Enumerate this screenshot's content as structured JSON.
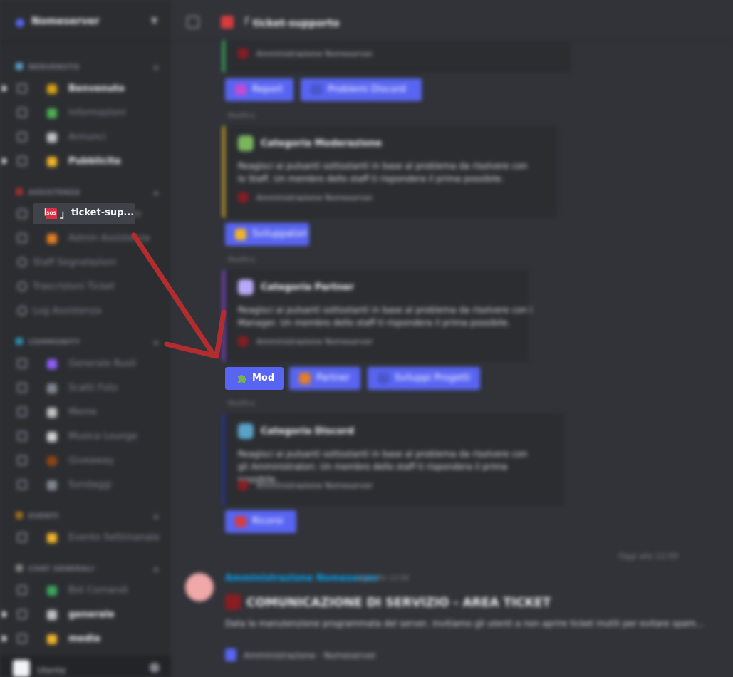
{
  "server": {
    "name": "Nomeserver"
  },
  "categories": [
    {
      "label": "Benvenuto",
      "color": "#5aa2c8"
    },
    {
      "label": "Assistenza",
      "color": "#a13131"
    },
    {
      "label": "Community",
      "color": "#2f8fb0"
    },
    {
      "label": "Eventi",
      "color": "#a06f1a"
    },
    {
      "label": "Chat Generali",
      "color": "#808080"
    }
  ],
  "channels": [
    {
      "label": "Benvenuto",
      "bold": true,
      "color": "#d4a017"
    },
    {
      "label": "Informazioni",
      "bold": false,
      "color": "#4caf50"
    },
    {
      "label": "Annunci",
      "bold": false,
      "color": "#c0c0c0"
    },
    {
      "label": "Pubblicita",
      "bold": true,
      "color": "#f0b429"
    },
    {
      "label": "Ticket Supporto",
      "bold": false,
      "color": "#d83c3e"
    },
    {
      "label": "Admin Assistenza",
      "bold": false,
      "color": "#e67e22"
    },
    {
      "label": "Staff Segnalazioni",
      "bold": false,
      "color": "#80848e"
    },
    {
      "label": "Trascrizioni Ticket",
      "bold": false,
      "color": "#80848e"
    },
    {
      "label": "Log Assistenza",
      "bold": false,
      "color": "#80848e"
    },
    {
      "label": "Generale Ruoli",
      "bold": false,
      "color": "#8e5cf7"
    },
    {
      "label": "Scatti Foto",
      "bold": false,
      "color": "#80848e"
    },
    {
      "label": "Meme",
      "bold": false,
      "color": "#c0c0c0"
    },
    {
      "label": "Musica Lounge",
      "bold": false,
      "color": "#d0d0d0"
    },
    {
      "label": "Giveaway",
      "bold": false,
      "color": "#8b4513"
    },
    {
      "label": "Sondaggi",
      "bold": false,
      "color": "#80848e"
    },
    {
      "label": "Evento Settimanale",
      "bold": false,
      "color": "#f0b429"
    },
    {
      "label": "Bot Comandi",
      "bold": false,
      "color": "#3ba55c"
    },
    {
      "label": "generale",
      "bold": true,
      "color": "#c0c0c0"
    },
    {
      "label": "media",
      "bold": true,
      "color": "#f0b429"
    }
  ],
  "highlighted_channel": {
    "bracket_left": "「",
    "icon_text": "SOS",
    "bracket_right": "」",
    "label": "ticket-sup..."
  },
  "user": {
    "name": "Utente"
  },
  "topbar": {
    "channel_name": "「 ticket-supporto"
  },
  "embeds": [
    {
      "title": "",
      "desc": "",
      "footer": "Amministrazione Nomeserver",
      "color": "#3ba55c",
      "icon_color": "#8b1c23"
    },
    {
      "title": "Categoria Moderazione",
      "desc": "Reagisci ai pulsanti sottostanti in base al problema da risolvere con lo Staff. Un membro dello staff ti rispondera il prima possibile.",
      "footer": "Amministrazione Nomeserver",
      "color": "#c5a028",
      "icon_color": "#7ab55c"
    },
    {
      "title": "Categoria Partner",
      "desc": "Reagisci ai pulsanti sottostanti in base al problema da risolvere con i Manager. Un membro dello staff ti rispondera il prima possibile.",
      "footer": "Amministrazione Nomeserver",
      "color": "#7b3fbf",
      "icon_color": "#b9a8f5"
    },
    {
      "title": "Categoria Discord",
      "desc": "Reagisci ai pulsanti sottostanti in base al problema da risolvere con gli Amministratori. Un membro dello staff ti rispondera il prima possibile.",
      "footer": "Amministrazione Nomeserver",
      "color": "#27338c",
      "icon_color": "#5aa2c8"
    }
  ],
  "buttons": [
    {
      "label": "Report",
      "icon_color": "#c44bd1"
    },
    {
      "label": "Problemi Discord",
      "icon_color": "#4a56c9"
    },
    {
      "label": "Sviluppatori",
      "icon_color": "#f0b429"
    },
    {
      "label": "Partner",
      "icon_color": "#e67e22"
    },
    {
      "label": "Sviluppi Progetti",
      "icon_color": "#4a56c9"
    },
    {
      "label": "Ricorsi",
      "icon_color": "#d83c3e"
    }
  ],
  "mod_button": {
    "label": "Mod",
    "icon": "puzzle-piece-icon",
    "icon_color": "#77b255"
  },
  "timestamps": [
    "Modifica",
    "Modifica",
    "Modifica",
    "Modifica"
  ],
  "message": {
    "author": "Amministrazione Nomeserver",
    "time": "oggi alle 12:00",
    "headline": "COMUNICAZIONE DI SERVIZIO - AREA TICKET",
    "body": "Data la manutenzione programmata del server, invitiamo gli utenti a non aprire ticket inutili per evitare spam...",
    "footer": "Amministrazione · Nomeserver",
    "date": "Oggi alle 12:00"
  }
}
